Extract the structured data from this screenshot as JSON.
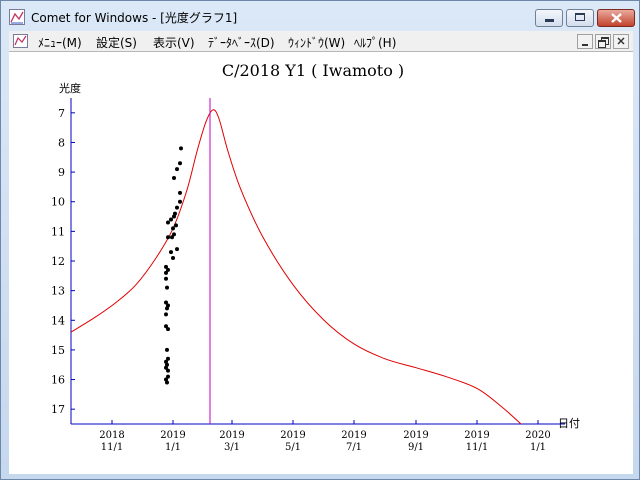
{
  "window": {
    "title": "Comet for Windows - [光度グラフ1]",
    "icon": "chart-icon"
  },
  "menu": [
    {
      "label": "ﾒﾆｭｰ(M)"
    },
    {
      "label": "設定(S)"
    },
    {
      "label": "表示(V)"
    },
    {
      "label": "ﾃﾞｰﾀﾍﾞｰｽ(D)"
    },
    {
      "label": "ｳｨﾝﾄﾞｳ(W)"
    },
    {
      "label": "ﾍﾙﾌﾟ(H)"
    }
  ],
  "chart_data": {
    "type": "scatter",
    "title": "C/2018 Y1 ( Iwamoto )",
    "ylabel": "光度",
    "xlabel": "日付",
    "y_inverted": true,
    "ylim": [
      17.5,
      6.5
    ],
    "yticks": [
      7,
      8,
      9,
      10,
      11,
      12,
      13,
      14,
      15,
      16,
      17
    ],
    "xlim": [
      "2018-09-21",
      "2020-01-20"
    ],
    "xticks": [
      {
        "date": "2018-11-01",
        "line1": "2018",
        "line2": "11/1"
      },
      {
        "date": "2019-01-01",
        "line1": "2019",
        "line2": "1/1"
      },
      {
        "date": "2019-03-01",
        "line1": "2019",
        "line2": "3/1"
      },
      {
        "date": "2019-05-01",
        "line1": "2019",
        "line2": "5/1"
      },
      {
        "date": "2019-07-01",
        "line1": "2019",
        "line2": "7/1"
      },
      {
        "date": "2019-09-01",
        "line1": "2019",
        "line2": "9/1"
      },
      {
        "date": "2019-11-01",
        "line1": "2019",
        "line2": "11/1"
      },
      {
        "date": "2020-01-01",
        "line1": "2020",
        "line2": "1/1"
      }
    ],
    "marker_line_date": "2019-02-07",
    "marker_line_color": "#c000c0",
    "curve_color": "#e00000",
    "points_color": "#000000",
    "axis_color": "#0000c0",
    "predicted_curve": [
      {
        "date": "2018-09-21",
        "mag": 14.4
      },
      {
        "date": "2018-10-15",
        "mag": 13.9
      },
      {
        "date": "2018-11-05",
        "mag": 13.4
      },
      {
        "date": "2018-11-25",
        "mag": 12.8
      },
      {
        "date": "2018-12-15",
        "mag": 11.9
      },
      {
        "date": "2019-01-01",
        "mag": 10.9
      },
      {
        "date": "2019-01-15",
        "mag": 9.6
      },
      {
        "date": "2019-01-25",
        "mag": 8.3
      },
      {
        "date": "2019-02-03",
        "mag": 7.3
      },
      {
        "date": "2019-02-10",
        "mag": 6.9
      },
      {
        "date": "2019-02-16",
        "mag": 7.2
      },
      {
        "date": "2019-02-25",
        "mag": 8.3
      },
      {
        "date": "2019-03-10",
        "mag": 9.6
      },
      {
        "date": "2019-04-01",
        "mag": 11.2
      },
      {
        "date": "2019-05-01",
        "mag": 12.8
      },
      {
        "date": "2019-06-01",
        "mag": 14.0
      },
      {
        "date": "2019-07-01",
        "mag": 14.8
      },
      {
        "date": "2019-08-01",
        "mag": 15.3
      },
      {
        "date": "2019-09-01",
        "mag": 15.6
      },
      {
        "date": "2019-10-01",
        "mag": 15.9
      },
      {
        "date": "2019-11-01",
        "mag": 16.3
      },
      {
        "date": "2019-11-25",
        "mag": 16.9
      },
      {
        "date": "2019-12-15",
        "mag": 17.5
      },
      {
        "date": "2019-12-28",
        "mag": 17.9
      }
    ],
    "observations": [
      {
        "date": "2018-12-25",
        "mag": 12.2
      },
      {
        "date": "2018-12-25",
        "mag": 12.4
      },
      {
        "date": "2018-12-25",
        "mag": 12.6
      },
      {
        "date": "2018-12-25",
        "mag": 13.4
      },
      {
        "date": "2018-12-25",
        "mag": 13.8
      },
      {
        "date": "2018-12-25",
        "mag": 14.2
      },
      {
        "date": "2018-12-25",
        "mag": 15.4
      },
      {
        "date": "2018-12-25",
        "mag": 15.6
      },
      {
        "date": "2018-12-25",
        "mag": 16.0
      },
      {
        "date": "2018-12-26",
        "mag": 12.9
      },
      {
        "date": "2018-12-26",
        "mag": 13.6
      },
      {
        "date": "2018-12-26",
        "mag": 15.0
      },
      {
        "date": "2018-12-26",
        "mag": 15.5
      },
      {
        "date": "2018-12-26",
        "mag": 16.1
      },
      {
        "date": "2018-12-27",
        "mag": 10.7
      },
      {
        "date": "2018-12-27",
        "mag": 11.2
      },
      {
        "date": "2018-12-27",
        "mag": 12.3
      },
      {
        "date": "2018-12-27",
        "mag": 13.5
      },
      {
        "date": "2018-12-27",
        "mag": 14.3
      },
      {
        "date": "2018-12-27",
        "mag": 15.3
      },
      {
        "date": "2018-12-27",
        "mag": 15.7
      },
      {
        "date": "2018-12-27",
        "mag": 15.9
      },
      {
        "date": "2018-12-30",
        "mag": 10.6
      },
      {
        "date": "2018-12-30",
        "mag": 11.7
      },
      {
        "date": "2018-12-31",
        "mag": 11.2
      },
      {
        "date": "2019-01-01",
        "mag": 10.9
      },
      {
        "date": "2019-01-01",
        "mag": 11.9
      },
      {
        "date": "2019-01-02",
        "mag": 9.2
      },
      {
        "date": "2019-01-02",
        "mag": 10.5
      },
      {
        "date": "2019-01-02",
        "mag": 11.1
      },
      {
        "date": "2019-01-03",
        "mag": 10.4
      },
      {
        "date": "2019-01-04",
        "mag": 10.8
      },
      {
        "date": "2019-01-05",
        "mag": 8.9
      },
      {
        "date": "2019-01-05",
        "mag": 10.2
      },
      {
        "date": "2019-01-05",
        "mag": 11.6
      },
      {
        "date": "2019-01-08",
        "mag": 9.7
      },
      {
        "date": "2019-01-08",
        "mag": 10.0
      },
      {
        "date": "2019-01-08",
        "mag": 8.7
      },
      {
        "date": "2019-01-09",
        "mag": 8.2
      }
    ]
  }
}
